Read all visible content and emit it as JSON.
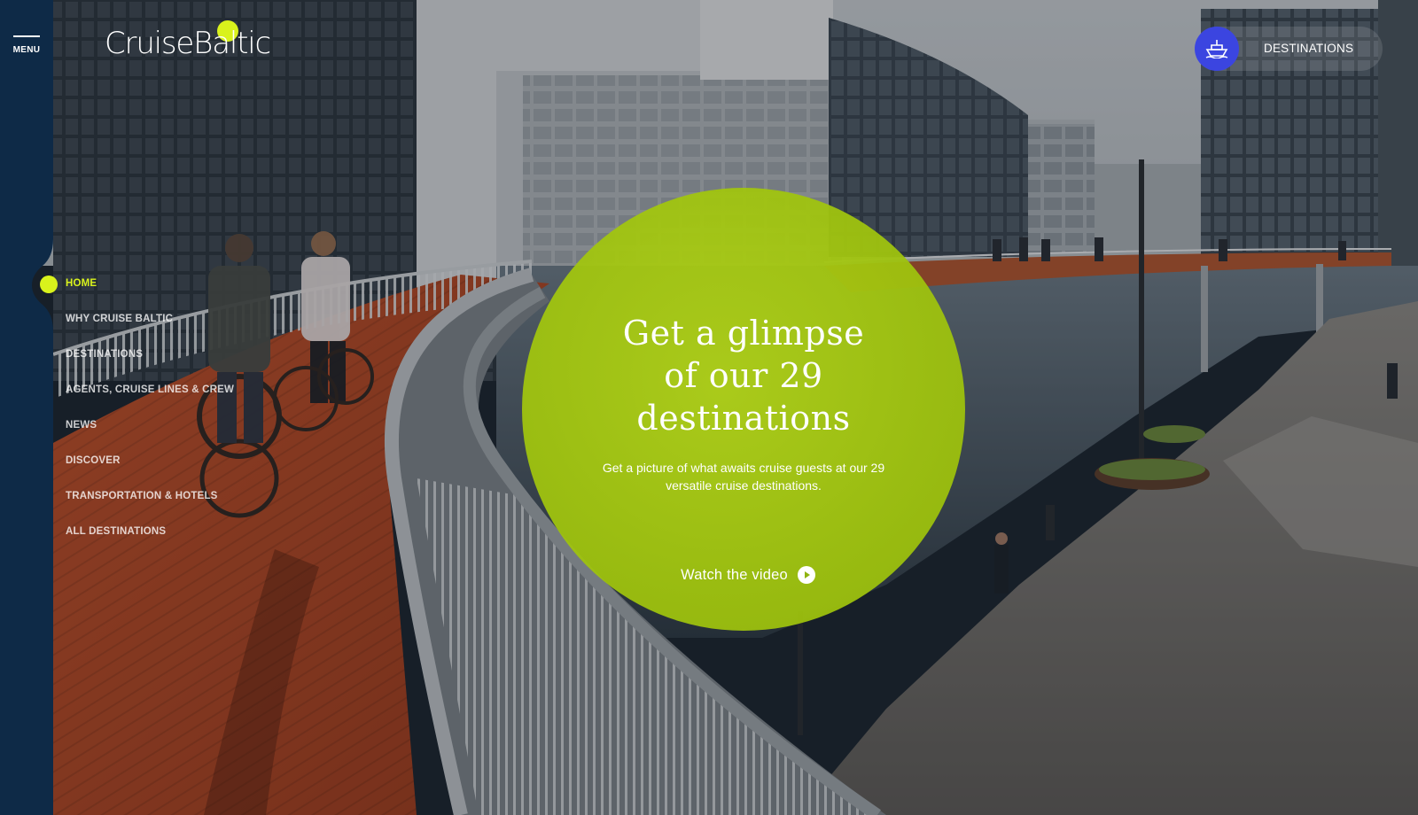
{
  "brand": {
    "name": "CruiseBaltic",
    "accent": "#d9f21c",
    "navy": "#0e2a47",
    "button_blue": "#3b45e0"
  },
  "header": {
    "menu_label": "MENU",
    "destinations_label": "DESTINATIONS",
    "destinations_icon": "ship-icon"
  },
  "sidebar": {
    "items": [
      {
        "label": "HOME",
        "active": true
      },
      {
        "label": "WHY CRUISE BALTIC",
        "active": false
      },
      {
        "label": "DESTINATIONS",
        "active": false
      },
      {
        "label": "AGENTS, CRUISE LINES & CREW",
        "active": false
      },
      {
        "label": "NEWS",
        "active": false
      },
      {
        "label": "DISCOVER",
        "active": false
      },
      {
        "label": "TRANSPORTATION & HOTELS",
        "active": false
      },
      {
        "label": "ALL DESTINATIONS",
        "active": false
      }
    ]
  },
  "hero": {
    "title": "Get a glimpse\nof our 29\ndestinations",
    "description": "Get a picture of what awaits cruise guests at our 29 versatile cruise destinations.",
    "cta_label": "Watch the video",
    "cta_icon": "play-icon",
    "circle_color": "#a6c812"
  }
}
